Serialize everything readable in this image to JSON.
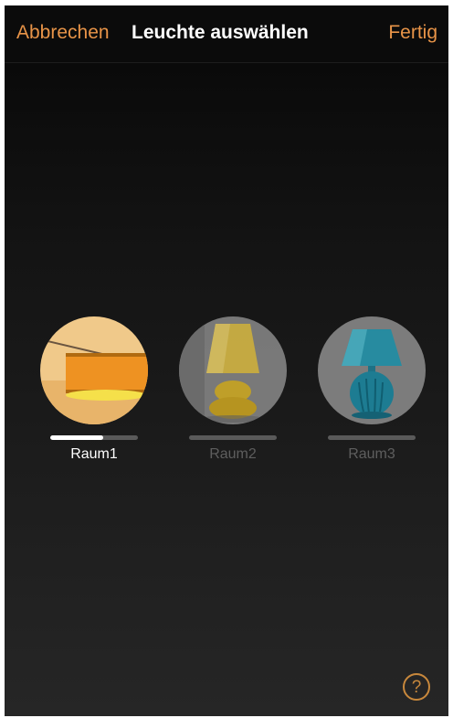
{
  "header": {
    "cancel_label": "Abbrechen",
    "title": "Leuchte auswählen",
    "done_label": "Fertig"
  },
  "lamps": [
    {
      "label": "Raum1",
      "selected": true,
      "level": 0.6
    },
    {
      "label": "Raum2",
      "selected": false,
      "level": 0
    },
    {
      "label": "Raum3",
      "selected": false,
      "level": 0
    }
  ],
  "help": {
    "icon": "question-circle-icon",
    "symbol": "?"
  },
  "colors": {
    "accent": "#e89448",
    "text": "#ffffff",
    "inactive_text": "#5e5e5e"
  }
}
